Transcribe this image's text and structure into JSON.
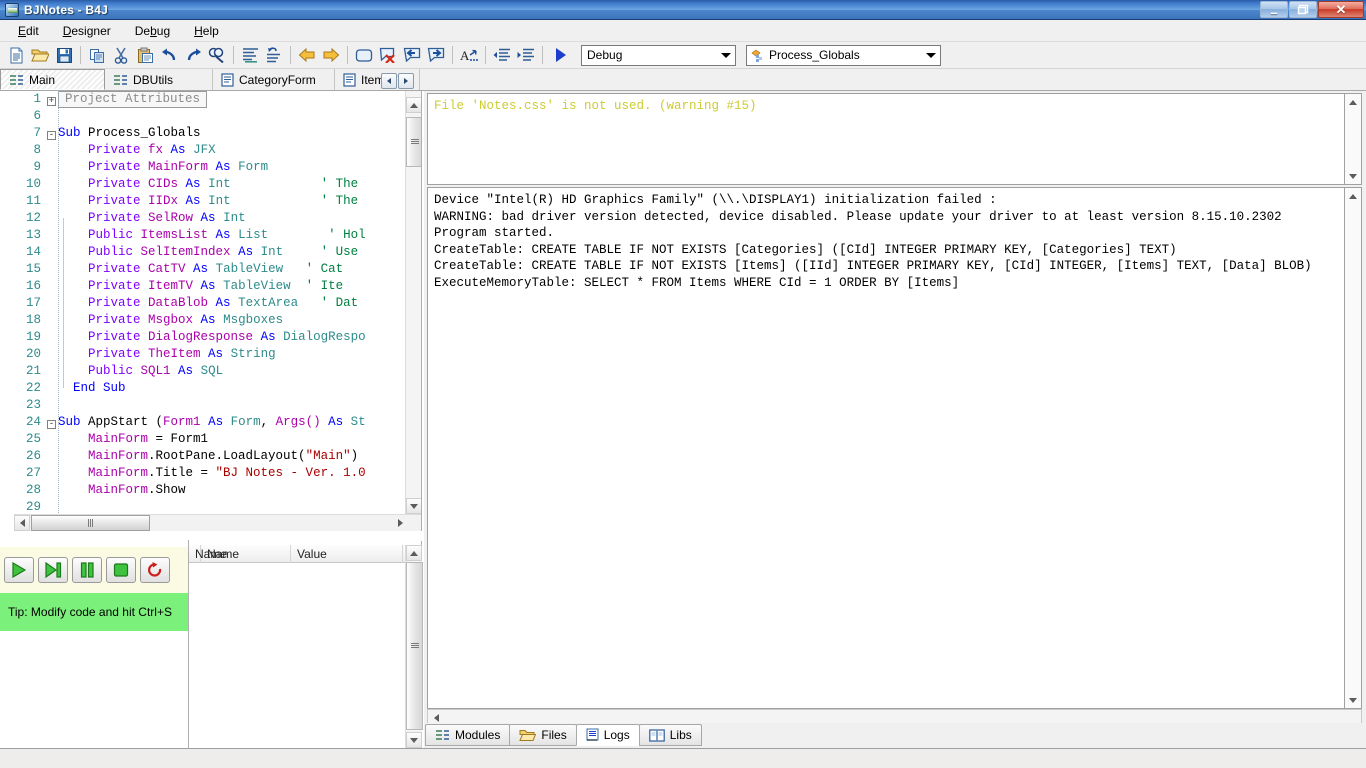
{
  "window": {
    "title": "BJNotes - B4J",
    "icon": "app-icon",
    "controls": {
      "minimize": "–",
      "maximize": "❐",
      "close": "✕"
    }
  },
  "menubar": {
    "items": [
      {
        "label": "Edit",
        "accel": "E"
      },
      {
        "label": "Designer",
        "accel": "D"
      },
      {
        "label": "Debug",
        "accel": "b"
      },
      {
        "label": "Help",
        "accel": "H"
      }
    ]
  },
  "toolbar": {
    "buttons": [
      {
        "name": "new-file-icon",
        "title": "New"
      },
      {
        "name": "open-folder-icon",
        "title": "Open"
      },
      {
        "name": "save-icon",
        "title": "Save"
      },
      {
        "name": "copy-icon",
        "title": "Copy"
      },
      {
        "name": "cut-icon",
        "title": "Cut"
      },
      {
        "name": "paste-icon",
        "title": "Paste"
      },
      {
        "name": "undo-icon",
        "title": "Undo"
      },
      {
        "name": "redo-icon",
        "title": "Redo"
      },
      {
        "name": "find-icon",
        "title": "Find"
      },
      {
        "name": "format-lines-icon",
        "title": "Format"
      },
      {
        "name": "sort-undo-icon",
        "title": "Restore"
      },
      {
        "name": "back-arrow-icon",
        "title": "Back"
      },
      {
        "name": "forward-arrow-icon",
        "title": "Forward"
      },
      {
        "name": "bookmark-icon",
        "title": "Bookmark"
      },
      {
        "name": "clear-bookmarks-icon",
        "title": "Clear bookmarks"
      },
      {
        "name": "prev-bookmark-icon",
        "title": "Previous bookmark"
      },
      {
        "name": "next-bookmark-icon",
        "title": "Next bookmark"
      },
      {
        "name": "font-size-icon",
        "title": "Font"
      },
      {
        "name": "outdent-icon",
        "title": "Outdent"
      },
      {
        "name": "indent-icon",
        "title": "Indent"
      },
      {
        "name": "run-icon",
        "title": "Run"
      }
    ],
    "build_mode": {
      "value": "Debug",
      "name": "build-configuration-select"
    },
    "navigate_to": {
      "value": "Process_Globals",
      "name": "code-navigation-select"
    }
  },
  "module_tabs": {
    "items": [
      {
        "label": "Main",
        "icon": "code-module-icon",
        "active": true
      },
      {
        "label": "DBUtils",
        "icon": "code-module-icon",
        "active": false
      },
      {
        "label": "CategoryForm",
        "icon": "form-module-icon",
        "active": false
      },
      {
        "label": "ItemsFo",
        "icon": "form-module-icon",
        "active": false
      }
    ],
    "scroll_left": "◄",
    "scroll_right": "►"
  },
  "code": {
    "attribute_block": "Project Attributes",
    "lines": [
      {
        "num": "1",
        "fold": "+",
        "tokens": [
          {
            "t": "attrbox",
            "s": "Project Attributes"
          }
        ]
      },
      {
        "num": "6",
        "fold": "",
        "tokens": []
      },
      {
        "num": "7",
        "fold": "-",
        "tokens": [
          {
            "t": "kw",
            "s": "Sub "
          },
          {
            "t": "plain",
            "s": "Process_Globals"
          }
        ]
      },
      {
        "num": "8",
        "fold": "",
        "tokens": [
          {
            "t": "ind",
            "s": "    "
          },
          {
            "t": "kw2",
            "s": "Private "
          },
          {
            "t": "ident",
            "s": "fx "
          },
          {
            "t": "kw",
            "s": "As "
          },
          {
            "t": "typ",
            "s": "JFX"
          }
        ]
      },
      {
        "num": "9",
        "fold": "",
        "tokens": [
          {
            "t": "ind",
            "s": "    "
          },
          {
            "t": "kw2",
            "s": "Private "
          },
          {
            "t": "ident",
            "s": "MainForm "
          },
          {
            "t": "kw",
            "s": "As "
          },
          {
            "t": "typ",
            "s": "Form"
          }
        ]
      },
      {
        "num": "10",
        "fold": "",
        "tokens": [
          {
            "t": "ind",
            "s": "    "
          },
          {
            "t": "kw2",
            "s": "Private "
          },
          {
            "t": "ident",
            "s": "CIDs "
          },
          {
            "t": "kw",
            "s": "As "
          },
          {
            "t": "typ",
            "s": "Int"
          },
          {
            "t": "pad",
            "s": "            "
          },
          {
            "t": "cmt",
            "s": "' The"
          }
        ]
      },
      {
        "num": "11",
        "fold": "",
        "tokens": [
          {
            "t": "ind",
            "s": "    "
          },
          {
            "t": "kw2",
            "s": "Private "
          },
          {
            "t": "ident",
            "s": "IIDx "
          },
          {
            "t": "kw",
            "s": "As "
          },
          {
            "t": "typ",
            "s": "Int"
          },
          {
            "t": "pad",
            "s": "            "
          },
          {
            "t": "cmt",
            "s": "' The"
          }
        ]
      },
      {
        "num": "12",
        "fold": "",
        "tokens": [
          {
            "t": "ind",
            "s": "    "
          },
          {
            "t": "kw2",
            "s": "Private "
          },
          {
            "t": "ident",
            "s": "SelRow "
          },
          {
            "t": "kw",
            "s": "As "
          },
          {
            "t": "typ",
            "s": "Int"
          }
        ]
      },
      {
        "num": "13",
        "fold": "",
        "tokens": [
          {
            "t": "ind",
            "s": "    "
          },
          {
            "t": "kw2",
            "s": "Public "
          },
          {
            "t": "ident",
            "s": "ItemsList "
          },
          {
            "t": "kw",
            "s": "As "
          },
          {
            "t": "typ",
            "s": "List"
          },
          {
            "t": "pad",
            "s": "        "
          },
          {
            "t": "cmt",
            "s": "' Hol"
          }
        ]
      },
      {
        "num": "14",
        "fold": "",
        "tokens": [
          {
            "t": "ind",
            "s": "    "
          },
          {
            "t": "kw2",
            "s": "Public "
          },
          {
            "t": "ident",
            "s": "SelItemIndex "
          },
          {
            "t": "kw",
            "s": "As "
          },
          {
            "t": "typ",
            "s": "Int"
          },
          {
            "t": "pad",
            "s": "     "
          },
          {
            "t": "cmt",
            "s": "' Use"
          }
        ]
      },
      {
        "num": "15",
        "fold": "",
        "tokens": [
          {
            "t": "ind",
            "s": "    "
          },
          {
            "t": "kw2",
            "s": "Private "
          },
          {
            "t": "ident",
            "s": "CatTV "
          },
          {
            "t": "kw",
            "s": "As "
          },
          {
            "t": "typ",
            "s": "TableView"
          },
          {
            "t": "pad",
            "s": "   "
          },
          {
            "t": "cmt",
            "s": "' Cat"
          }
        ]
      },
      {
        "num": "16",
        "fold": "",
        "tokens": [
          {
            "t": "ind",
            "s": "    "
          },
          {
            "t": "kw2",
            "s": "Private "
          },
          {
            "t": "ident",
            "s": "ItemTV "
          },
          {
            "t": "kw",
            "s": "As "
          },
          {
            "t": "typ",
            "s": "TableView"
          },
          {
            "t": "pad",
            "s": "  "
          },
          {
            "t": "cmt",
            "s": "' Ite"
          }
        ]
      },
      {
        "num": "17",
        "fold": "",
        "tokens": [
          {
            "t": "ind",
            "s": "    "
          },
          {
            "t": "kw2",
            "s": "Private "
          },
          {
            "t": "ident",
            "s": "DataBlob "
          },
          {
            "t": "kw",
            "s": "As "
          },
          {
            "t": "typ",
            "s": "TextArea"
          },
          {
            "t": "pad",
            "s": "   "
          },
          {
            "t": "cmt",
            "s": "' Dat"
          }
        ]
      },
      {
        "num": "18",
        "fold": "",
        "tokens": [
          {
            "t": "ind",
            "s": "    "
          },
          {
            "t": "kw2",
            "s": "Private "
          },
          {
            "t": "ident",
            "s": "Msgbox "
          },
          {
            "t": "kw",
            "s": "As "
          },
          {
            "t": "typ",
            "s": "Msgboxes"
          }
        ]
      },
      {
        "num": "19",
        "fold": "",
        "tokens": [
          {
            "t": "ind",
            "s": "    "
          },
          {
            "t": "kw2",
            "s": "Private "
          },
          {
            "t": "ident",
            "s": "DialogResponse "
          },
          {
            "t": "kw",
            "s": "As "
          },
          {
            "t": "typ",
            "s": "DialogRespo"
          }
        ]
      },
      {
        "num": "20",
        "fold": "",
        "tokens": [
          {
            "t": "ind",
            "s": "    "
          },
          {
            "t": "kw2",
            "s": "Private "
          },
          {
            "t": "ident",
            "s": "TheItem "
          },
          {
            "t": "kw",
            "s": "As "
          },
          {
            "t": "typ",
            "s": "String"
          }
        ]
      },
      {
        "num": "21",
        "fold": "",
        "tokens": [
          {
            "t": "ind",
            "s": "    "
          },
          {
            "t": "kw2",
            "s": "Public "
          },
          {
            "t": "ident",
            "s": "SQL1 "
          },
          {
            "t": "kw",
            "s": "As "
          },
          {
            "t": "typ",
            "s": "SQL"
          }
        ]
      },
      {
        "num": "22",
        "fold": "",
        "tokens": [
          {
            "t": "ind",
            "s": "  "
          },
          {
            "t": "kw",
            "s": "End Sub"
          }
        ]
      },
      {
        "num": "23",
        "fold": "",
        "tokens": []
      },
      {
        "num": "24",
        "fold": "-",
        "tokens": [
          {
            "t": "kw",
            "s": "Sub "
          },
          {
            "t": "plain",
            "s": "AppStart "
          },
          {
            "t": "plain",
            "s": "("
          },
          {
            "t": "ident2",
            "s": "Form1 "
          },
          {
            "t": "kw",
            "s": "As "
          },
          {
            "t": "typ",
            "s": "Form"
          },
          {
            "t": "plain",
            "s": ", "
          },
          {
            "t": "ident2",
            "s": "Args() "
          },
          {
            "t": "kw",
            "s": "As "
          },
          {
            "t": "typ",
            "s": "St"
          }
        ]
      },
      {
        "num": "25",
        "fold": "",
        "tokens": [
          {
            "t": "ind",
            "s": "    "
          },
          {
            "t": "ident",
            "s": "MainForm "
          },
          {
            "t": "plain",
            "s": "= "
          },
          {
            "t": "plain",
            "s": "Form1"
          }
        ]
      },
      {
        "num": "26",
        "fold": "",
        "tokens": [
          {
            "t": "ind",
            "s": "    "
          },
          {
            "t": "ident",
            "s": "MainForm"
          },
          {
            "t": "plain",
            "s": ".RootPane.LoadLayout("
          },
          {
            "t": "str",
            "s": "\"Main\""
          },
          {
            "t": "plain",
            "s": ")"
          }
        ]
      },
      {
        "num": "27",
        "fold": "",
        "tokens": [
          {
            "t": "ind",
            "s": "    "
          },
          {
            "t": "ident",
            "s": "MainForm"
          },
          {
            "t": "plain",
            "s": ".Title = "
          },
          {
            "t": "str",
            "s": "\"BJ Notes - Ver. 1.0"
          }
        ]
      },
      {
        "num": "28",
        "fold": "",
        "tokens": [
          {
            "t": "ind",
            "s": "    "
          },
          {
            "t": "ident",
            "s": "MainForm"
          },
          {
            "t": "plain",
            "s": ".Show"
          }
        ]
      },
      {
        "num": "29",
        "fold": "",
        "tokens": []
      }
    ]
  },
  "debug_toolbar": {
    "buttons": [
      {
        "name": "continue-button",
        "glyph": "play"
      },
      {
        "name": "step-over-button",
        "glyph": "step"
      },
      {
        "name": "pause-button",
        "glyph": "pause"
      },
      {
        "name": "stop-button",
        "glyph": "stop"
      },
      {
        "name": "restart-button",
        "glyph": "restart"
      }
    ]
  },
  "tip": {
    "text": "Tip: Modify code and hit Ctrl+S",
    "background": "#7bf07b"
  },
  "variables": {
    "columns": [
      "Name",
      "Value"
    ],
    "rows": []
  },
  "logs": {
    "warning_panel": {
      "name": "compiler-warnings-panel",
      "text": "File 'Notes.css' is not used. (warning #15)",
      "color": "#cccc33"
    },
    "output_panel": {
      "name": "program-output-panel",
      "lines": [
        "Device \"Intel(R) HD Graphics Family\" (\\\\.\\DISPLAY1) initialization failed :",
        "WARNING: bad driver version detected, device disabled. Please update your driver to at least version 8.15.10.2302",
        "Program started.",
        "CreateTable: CREATE TABLE IF NOT EXISTS [Categories] ([CId] INTEGER PRIMARY KEY, [Categories] TEXT)",
        "CreateTable: CREATE TABLE IF NOT EXISTS [Items] ([IId] INTEGER PRIMARY KEY, [CId] INTEGER, [Items] TEXT, [Data] BLOB)",
        "ExecuteMemoryTable: SELECT * FROM Items WHERE CId = 1 ORDER BY [Items]"
      ]
    }
  },
  "bottom_tabs": {
    "items": [
      {
        "label": "Modules",
        "icon": "modules-icon",
        "active": false
      },
      {
        "label": "Files",
        "icon": "folder-icon",
        "active": false
      },
      {
        "label": "Logs",
        "icon": "logs-icon",
        "active": true
      },
      {
        "label": "Libs",
        "icon": "book-icon",
        "active": false
      }
    ]
  },
  "colors": {
    "titlebar_blue": "#3f7ccc",
    "tip_green": "#7bf07b",
    "debug_toolbar_bg": "#fbfbe4",
    "warning_yellow": "#cccc33",
    "keyword_blue": "#0000ff",
    "modifier_purple": "#7f00ff",
    "type_teal": "#2e8b8b",
    "identifier_magenta": "#aa00aa",
    "string_red": "#aa0000",
    "comment_green": "#008040",
    "linenum_teal": "#2e8b8b"
  }
}
